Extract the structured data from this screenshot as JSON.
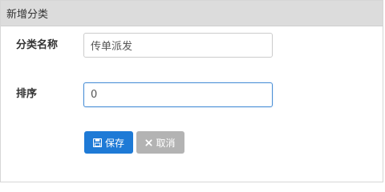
{
  "dialog": {
    "title": "新增分类"
  },
  "form": {
    "name_label": "分类名称",
    "name_value": "传单派发",
    "order_label": "排序",
    "order_value": "0"
  },
  "buttons": {
    "save_label": "保存",
    "save_icon": "floppy-disk-icon",
    "cancel_label": "取消",
    "cancel_icon": "close-icon"
  },
  "colors": {
    "header_bg": "#dcdcdc",
    "save_bg": "#1e7ad6",
    "cancel_bg": "#b3b3b3",
    "focus_border": "#4a8fd6"
  }
}
